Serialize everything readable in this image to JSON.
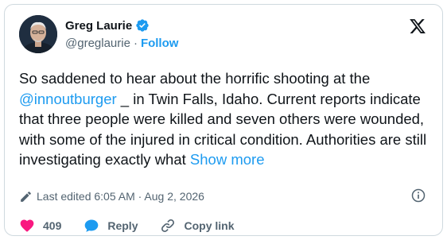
{
  "author": {
    "name": "Greg Laurie",
    "handle": "@greglaurie",
    "separator": "·",
    "follow_label": "Follow",
    "verified": true
  },
  "tweet": {
    "text_before": "So saddened to hear about the horrific shooting at the ",
    "mention": "@innoutburger",
    "text_after": " _ in Twin Falls, Idaho. Current reports indicate that three people were killed and seven others were wounded, with some of the injured in critical condition. Authorities are still investigating exactly what ",
    "show_more": "Show more"
  },
  "meta": {
    "edited_label": "Last edited 6:05 AM · Aug 2, 2026"
  },
  "actions": {
    "like_count": "409",
    "reply_label": "Reply",
    "copy_label": "Copy link"
  },
  "colors": {
    "accent": "#1d9bf0",
    "like": "#f91880",
    "text": "#0f1419",
    "muted": "#536471",
    "border": "#cfd9de"
  },
  "icons": [
    "verified-badge-icon",
    "x-logo-icon",
    "pencil-icon",
    "info-icon",
    "heart-icon",
    "reply-bubble-icon",
    "link-icon"
  ]
}
